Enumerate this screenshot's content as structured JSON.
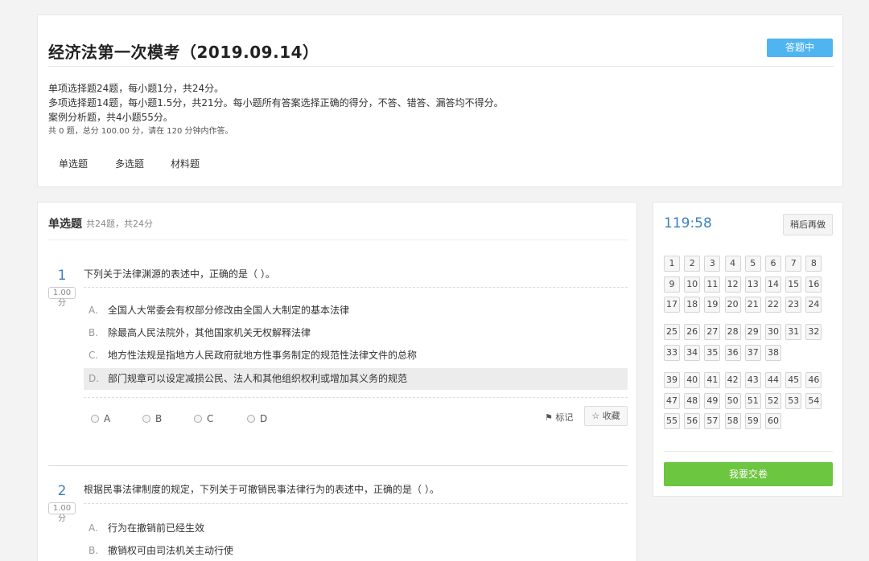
{
  "header": {
    "title": "经济法第一次模考（2019.09.14）",
    "status": "答题中",
    "rules": [
      "单项选择题24题，每小题1分，共24分。",
      "多项选择题14题，每小题1.5分，共21分。每小题所有答案选择正确的得分，不答、错答、漏答均不得分。",
      "案例分析题，共4小题55分。"
    ],
    "summary": "共 0 题，总分 100.00 分，请在 120 分钟内作答。",
    "tabs": [
      "单选题",
      "多选题",
      "材料题"
    ]
  },
  "section": {
    "title": "单选题",
    "meta": "共24题，共24分"
  },
  "questions": [
    {
      "number": "1",
      "score": "1.00分",
      "stem": "下列关于法律渊源的表述中，正确的是（  ）。",
      "options": [
        {
          "letter": "A.",
          "text": "全国人大常委会有权部分修改由全国人大制定的基本法律"
        },
        {
          "letter": "B.",
          "text": "除最高人民法院外，其他国家机关无权解释法律"
        },
        {
          "letter": "C.",
          "text": "地方性法规是指地方人民政府就地方性事务制定的规范性法律文件的总称"
        },
        {
          "letter": "D.",
          "text": "部门规章可以设定减损公民、法人和其他组织权利或增加其义务的规范"
        }
      ],
      "answers": [
        "A",
        "B",
        "C",
        "D"
      ]
    },
    {
      "number": "2",
      "score": "1.00分",
      "stem": "根据民事法律制度的规定，下列关于可撤销民事法律行为的表述中，正确的是（    ）。",
      "options": [
        {
          "letter": "A.",
          "text": "行为在撤销前已经生效"
        },
        {
          "letter": "B.",
          "text": "撤销权可由司法机关主动行使"
        }
      ]
    }
  ],
  "actions": {
    "mark": "标记",
    "favorite": "收藏"
  },
  "sidebar": {
    "timer": "119:58",
    "later": "稍后再做",
    "groups": [
      [
        "1",
        "2",
        "3",
        "4",
        "5",
        "6",
        "7",
        "8",
        "9",
        "10",
        "11",
        "12",
        "13",
        "14",
        "15",
        "16",
        "17",
        "18",
        "19",
        "20",
        "21",
        "22",
        "23",
        "24"
      ],
      [
        "25",
        "26",
        "27",
        "28",
        "29",
        "30",
        "31",
        "32",
        "33",
        "34",
        "35",
        "36",
        "37",
        "38"
      ],
      [
        "39",
        "40",
        "41",
        "42",
        "43",
        "44",
        "45",
        "46",
        "47",
        "48",
        "49",
        "50",
        "51",
        "52",
        "53",
        "54",
        "55",
        "56",
        "57",
        "58",
        "59",
        "60"
      ]
    ],
    "submit": "我要交卷"
  },
  "colors": {
    "accent": "#3a7fc1",
    "badge": "#4fb5f1",
    "submit": "#6cc63f"
  }
}
